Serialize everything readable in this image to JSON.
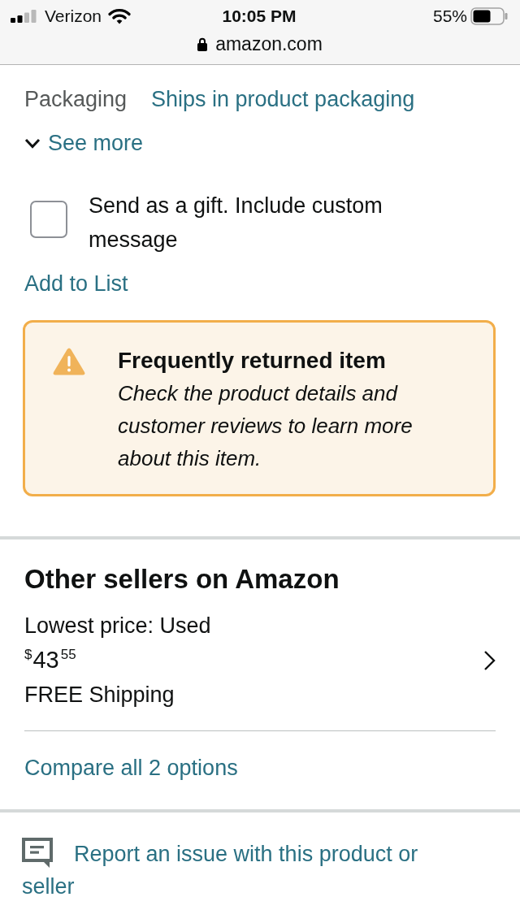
{
  "status_bar": {
    "carrier": "Verizon",
    "time": "10:05 PM",
    "battery": "55%",
    "url": "amazon.com"
  },
  "details": [
    {
      "label": "Packaging",
      "value": "Ships in product packaging"
    }
  ],
  "see_more": {
    "label": "See more",
    "expanded": false
  },
  "gift": {
    "label": "Send as a gift. Include custom message",
    "checked": false
  },
  "add_to_list": "Add to List",
  "alert": {
    "title": "Frequently returned item",
    "message": "Check the product details and customer reviews to learn more about this item."
  },
  "other_sellers": {
    "title": "Other sellers on Amazon",
    "offer_label": "Lowest price: Used",
    "price": {
      "symbol": "$",
      "whole": "43",
      "fraction": "55"
    },
    "shipping": "FREE Shipping",
    "compare_link": "Compare all 2 options"
  },
  "report_link": "Report an issue with this product or seller"
}
